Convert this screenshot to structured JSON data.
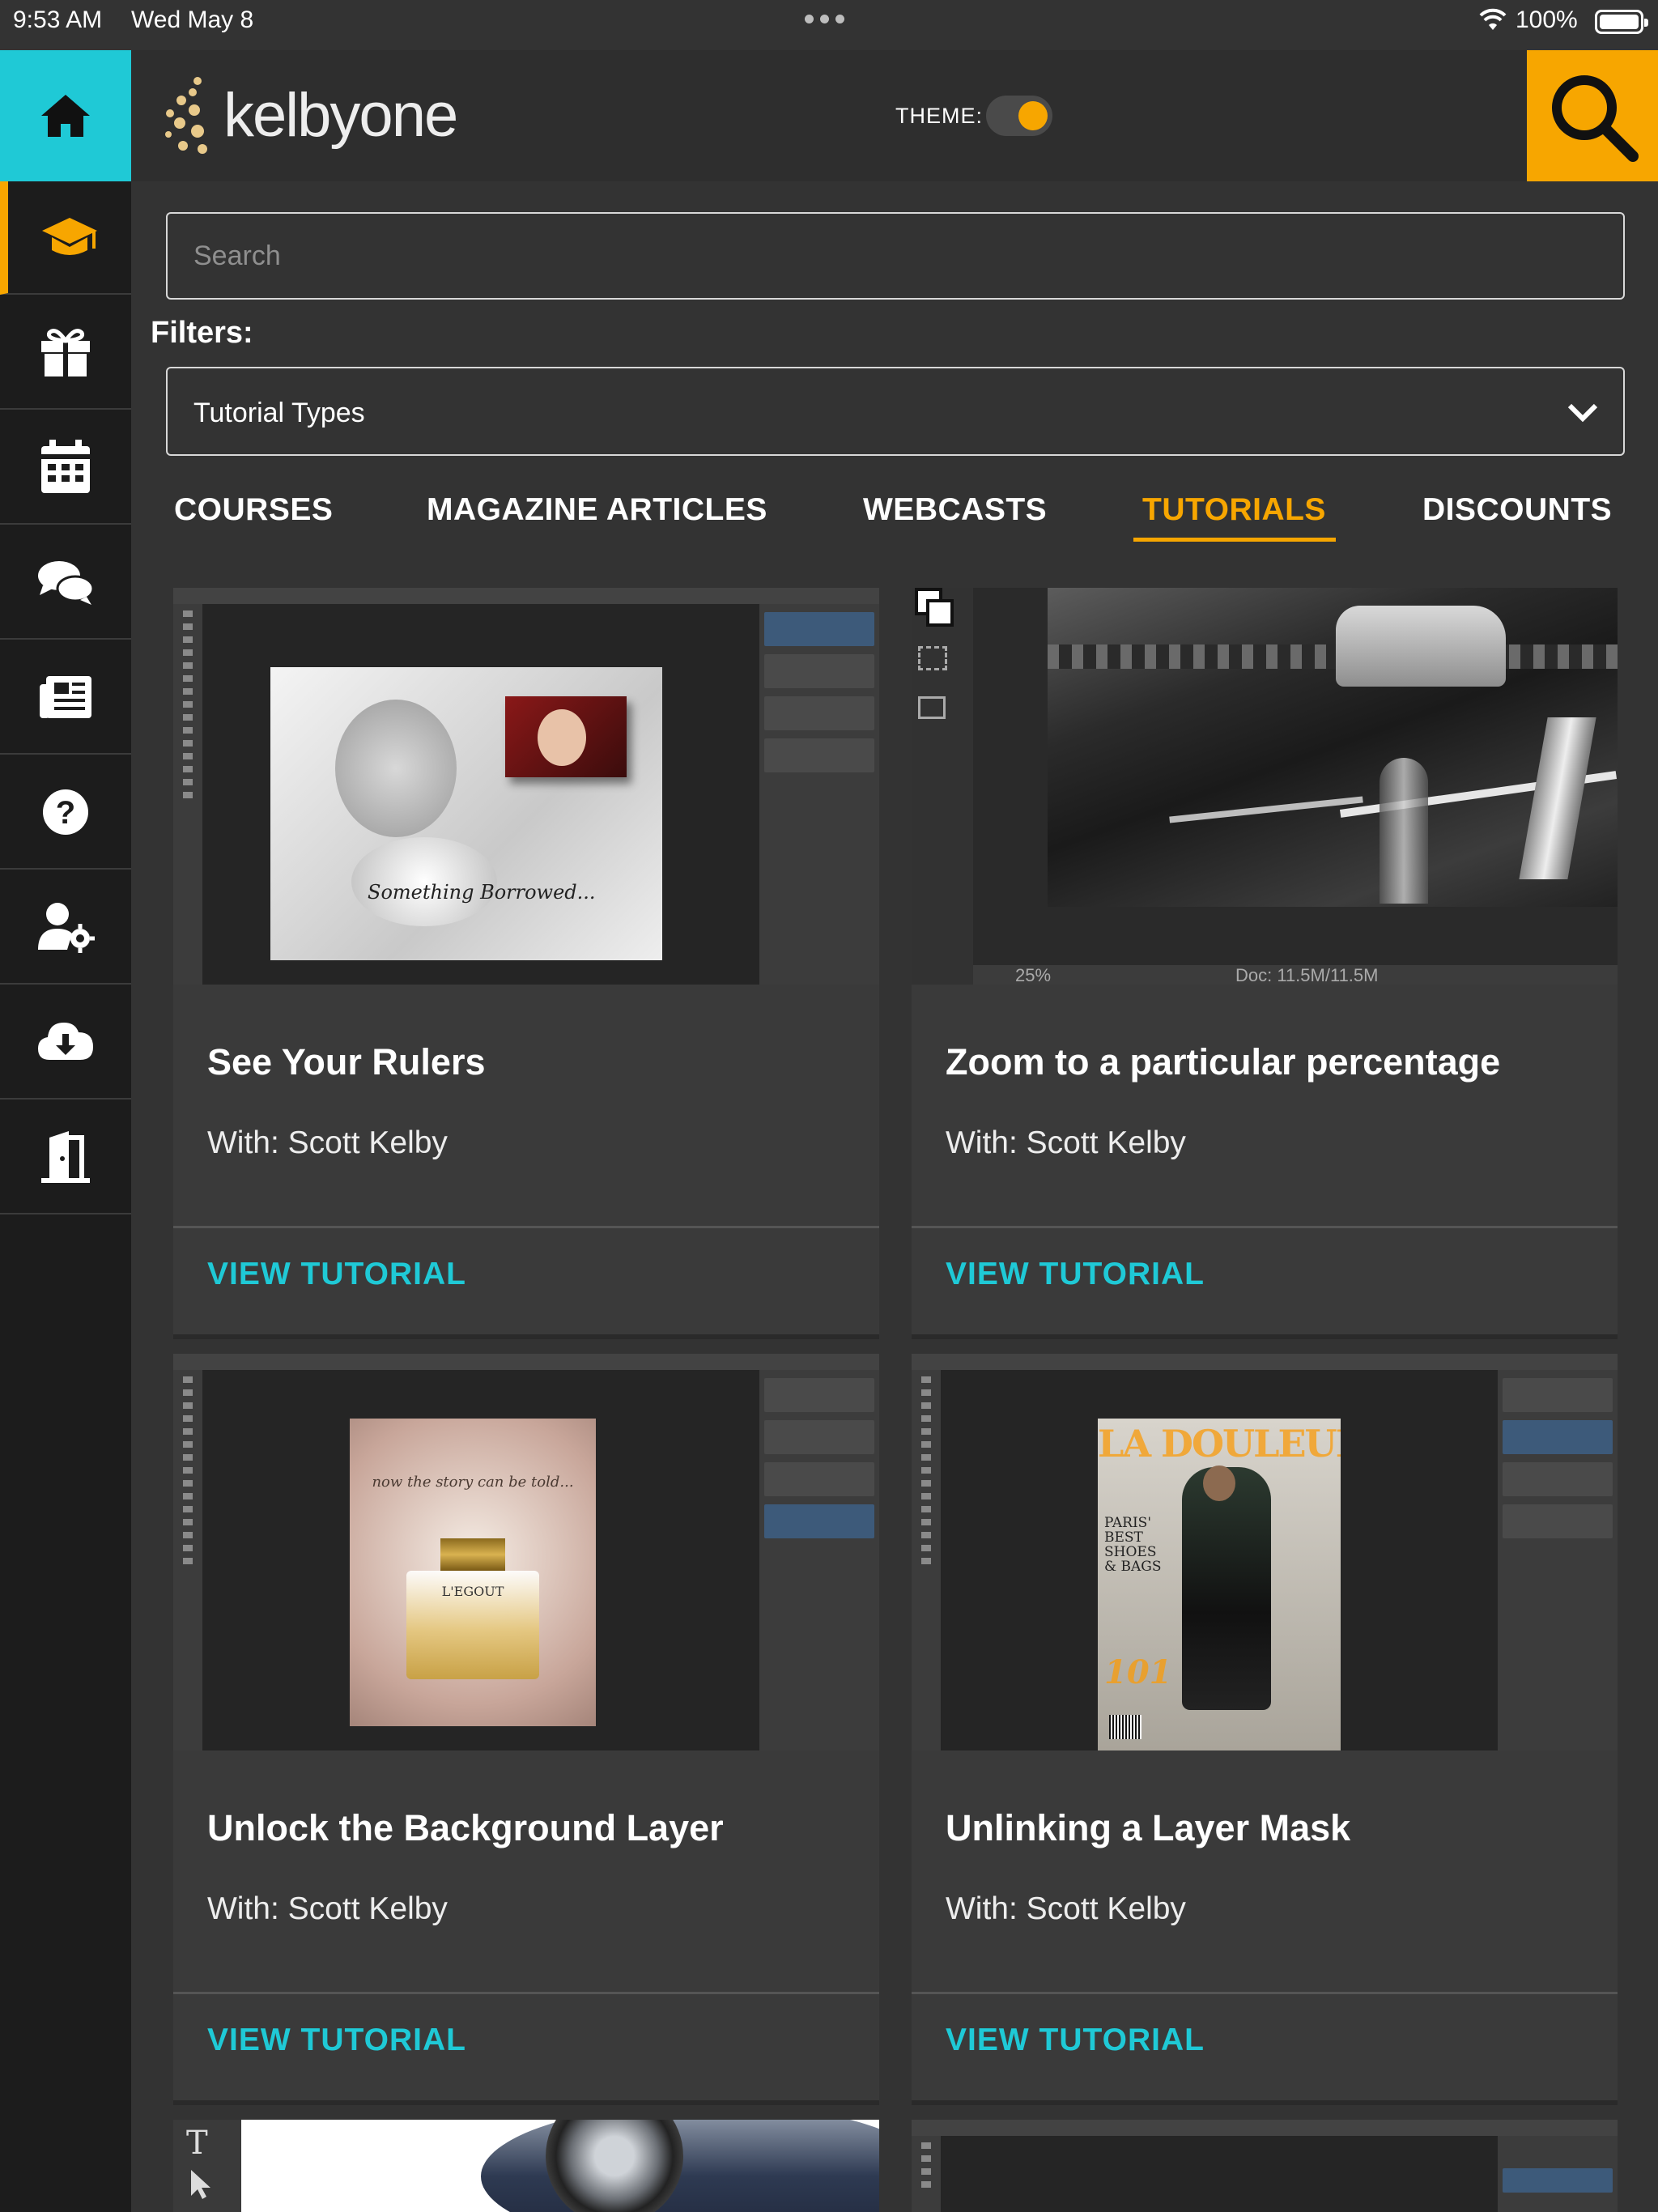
{
  "status": {
    "time": "9:53 AM",
    "date": "Wed May 8",
    "battery": "100%"
  },
  "header": {
    "logo": "kelbyone",
    "theme_label": "THEME:"
  },
  "search": {
    "placeholder": "Search"
  },
  "filters": {
    "label": "Filters:",
    "selected": "Tutorial Types"
  },
  "tabs": [
    {
      "label": "COURSES"
    },
    {
      "label": "MAGAZINE ARTICLES"
    },
    {
      "label": "WEBCASTS"
    },
    {
      "label": "TUTORIALS",
      "active": true
    },
    {
      "label": "DISCOUNTS"
    }
  ],
  "cards": [
    {
      "title": "See Your Rulers",
      "author": "With: Scott Kelby",
      "cta": "VIEW TUTORIAL",
      "thumb_text": "Something Borrowed..."
    },
    {
      "title": "Zoom to a particular percentage",
      "author": "With: Scott Kelby",
      "cta": "VIEW TUTORIAL",
      "thumb_text_a": "25%",
      "thumb_text_b": "Doc: 11.5M/11.5M"
    },
    {
      "title": "Unlock the Background Layer",
      "author": "With: Scott Kelby",
      "cta": "VIEW TUTORIAL",
      "thumb_text": "now the story can be told...",
      "thumb_text_b": "L'EGOUT"
    },
    {
      "title": "Unlinking a Layer Mask",
      "author": "With: Scott Kelby",
      "cta": "VIEW TUTORIAL",
      "thumb_text": "LA DOULEUR",
      "thumb_text_b": "101",
      "thumb_text_c": "PARIS' BEST SHOES & BAGS"
    }
  ],
  "colors": {
    "accent_orange": "#f7a600",
    "accent_cyan": "#1fc9d6",
    "background": "#333333",
    "sidebar": "#1c1c1c"
  },
  "sidebar_icons": [
    "home-icon",
    "graduation-cap-icon",
    "gift-icon",
    "calendar-icon",
    "chat-icon",
    "news-icon",
    "help-icon",
    "user-settings-icon",
    "cloud-download-icon",
    "logout-icon"
  ]
}
